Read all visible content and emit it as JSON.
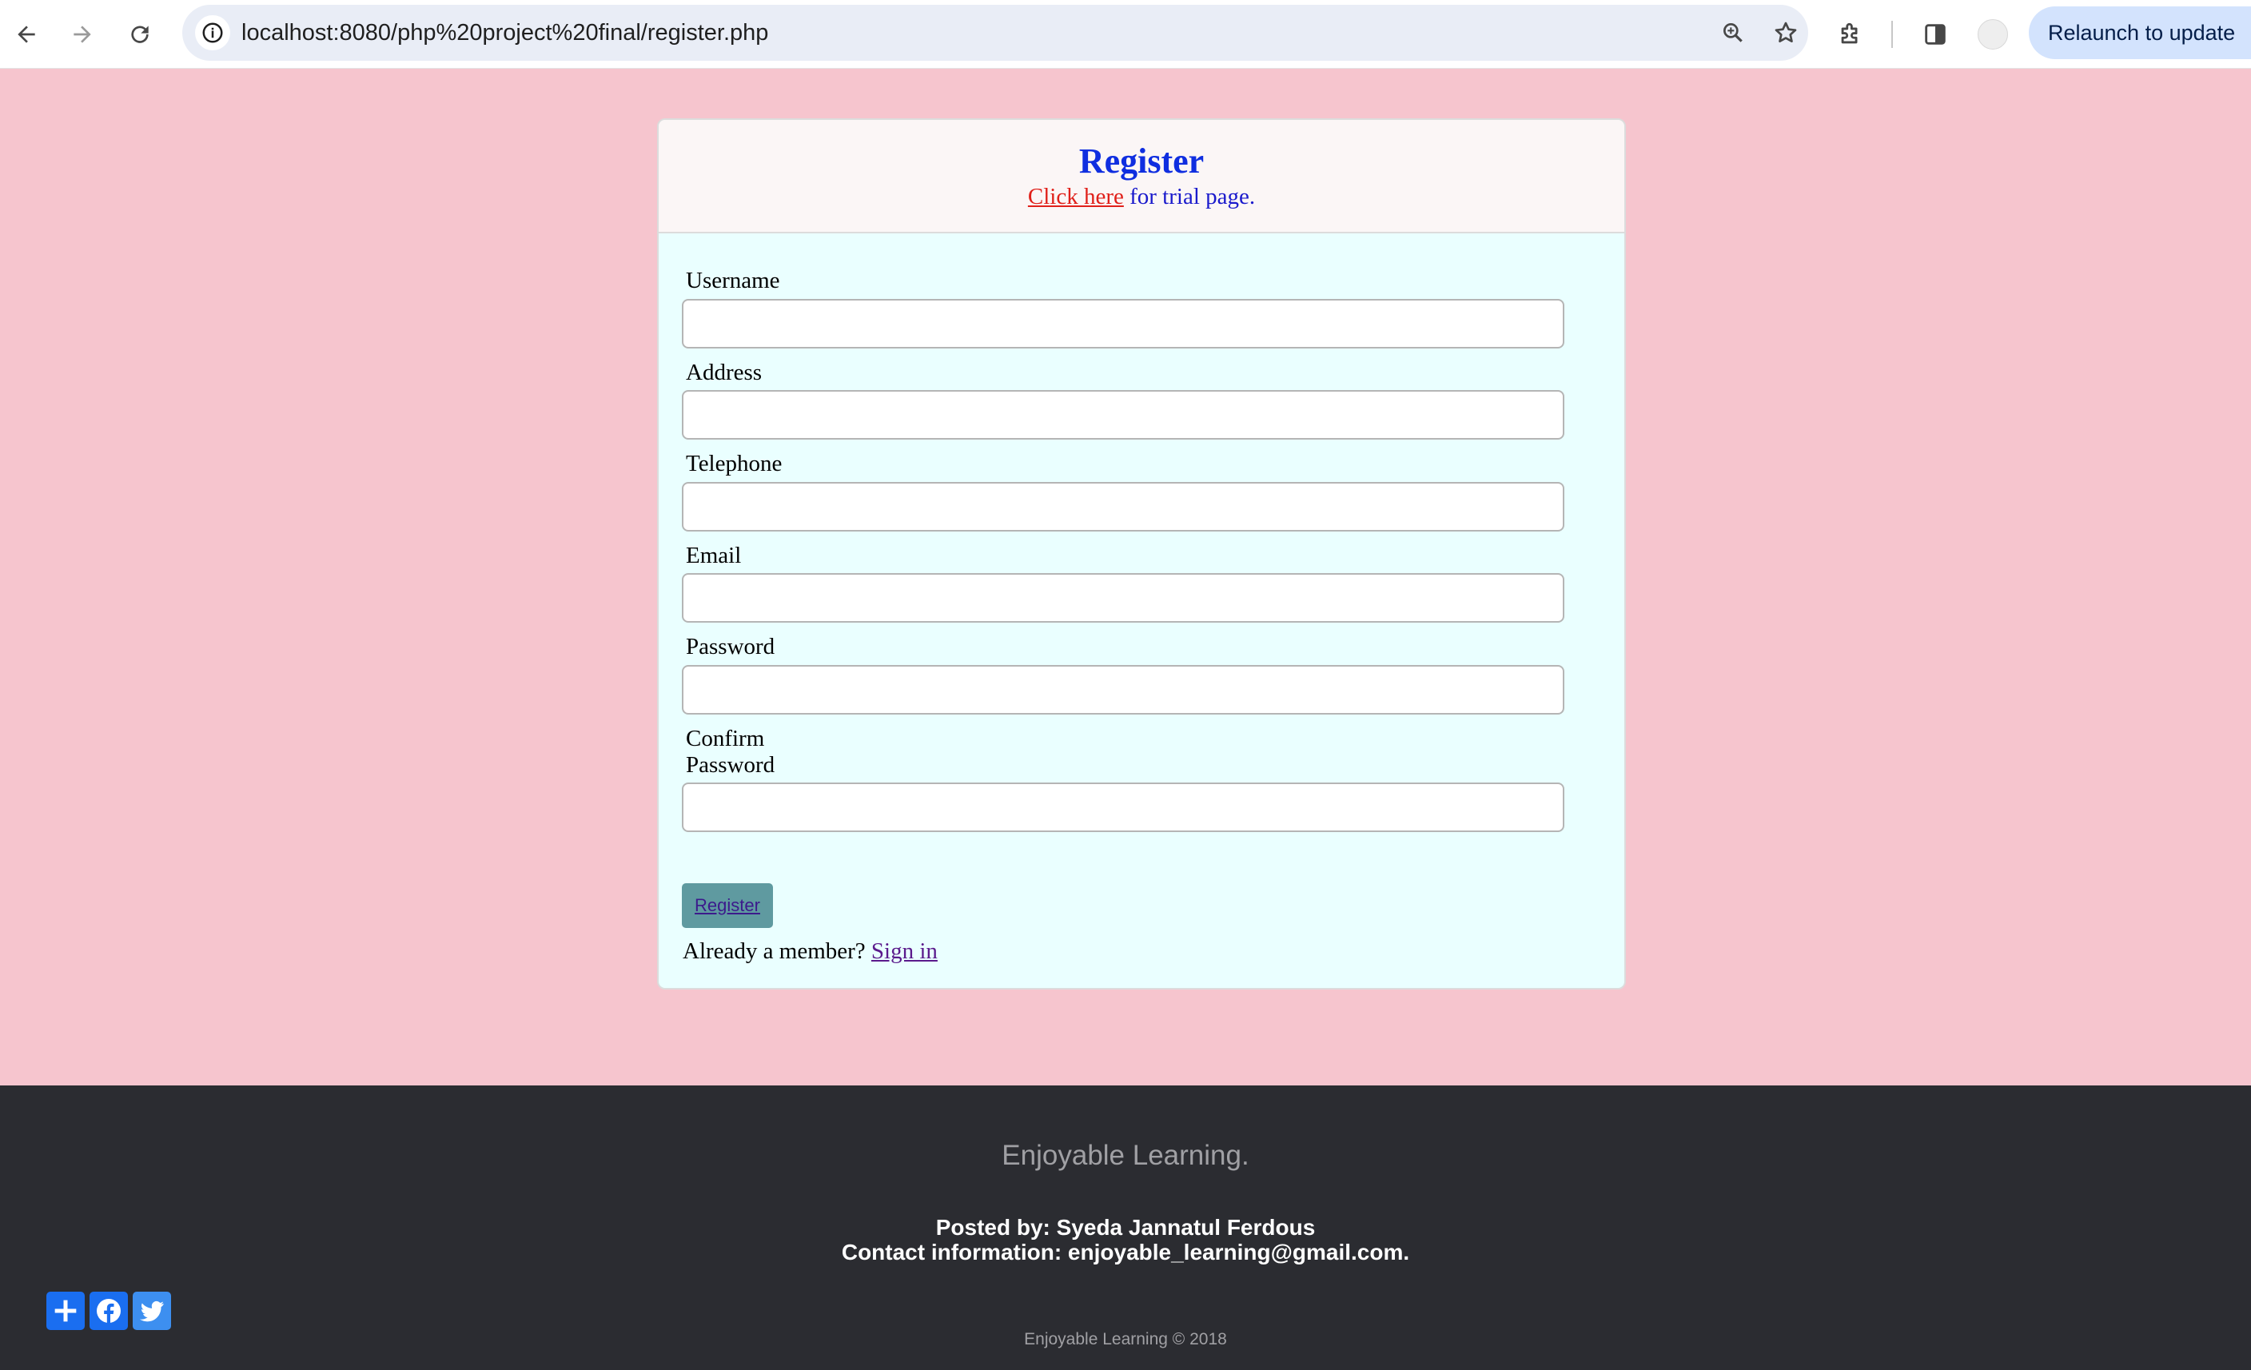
{
  "browser": {
    "url": "localhost:8080/php%20project%20final/register.php",
    "relaunch_label": "Relaunch to update",
    "icons": [
      "back-icon",
      "forward-icon",
      "reload-icon",
      "site-info-icon",
      "zoom-icon",
      "bookmark-star-icon",
      "extensions-icon",
      "side-panel-icon",
      "profile-avatar"
    ]
  },
  "card": {
    "title": "Register",
    "link_text": "Click here",
    "link_suffix": " for trial page.",
    "fields": [
      {
        "label": "Username",
        "value": ""
      },
      {
        "label": "Address",
        "value": ""
      },
      {
        "label": "Telephone",
        "value": ""
      },
      {
        "label": "Email",
        "value": ""
      },
      {
        "label": "Password",
        "value": ""
      },
      {
        "label_line1": "Confirm",
        "label_line2": "Password",
        "value": ""
      }
    ],
    "register_button": "Register",
    "member_text": "Already a member? ",
    "signin_link": "Sign in"
  },
  "footer": {
    "tagline": "Enjoyable Learning.",
    "posted_by": "Posted by: Syeda Jannatul Ferdous",
    "contact": "Contact information: enjoyable_learning@gmail.com.",
    "copyright": "Enjoyable Learning © 2018",
    "share_icons": [
      "add-share-icon",
      "facebook-icon",
      "twitter-icon"
    ]
  },
  "colors": {
    "page_background": "#f6c5ce",
    "card_background": "#eaffff",
    "title": "#0f2ee0",
    "link_red": "#e0201a",
    "button": "#5f9aa0",
    "footer_background": "#2b2c31",
    "share_blue": "#1a6ef0"
  }
}
